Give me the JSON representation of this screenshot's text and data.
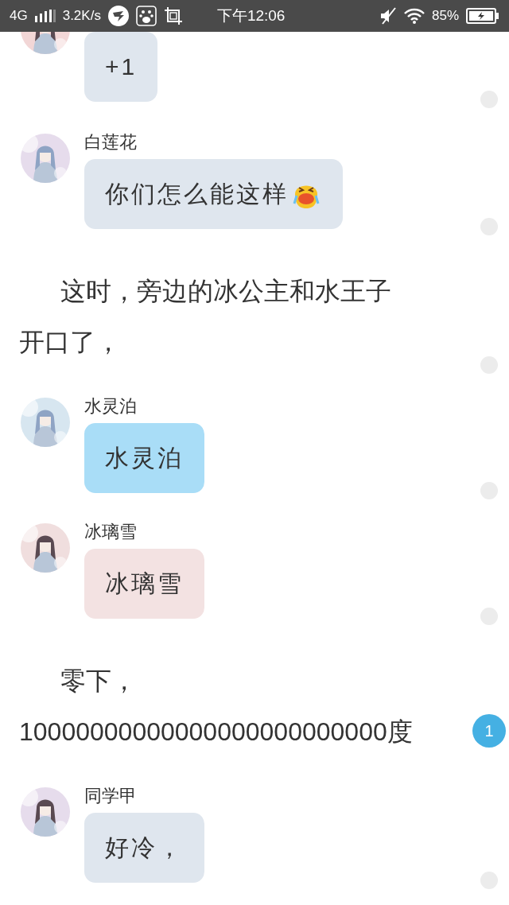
{
  "status_bar": {
    "network": "4G",
    "speed": "3.2K/s",
    "time": "下午12:06",
    "battery": "85%"
  },
  "items": [
    {
      "kind": "message",
      "bubble": {
        "text": "+1",
        "color": "#dfe6ee"
      }
    },
    {
      "kind": "message",
      "name": "白莲花",
      "bubble": {
        "text": "你们怎么能这样",
        "color": "#dfe6ee",
        "has_emoji": true
      }
    },
    {
      "kind": "narration",
      "lines": [
        "这时，旁边的冰公主和水王子",
        "开口了，"
      ]
    },
    {
      "kind": "message",
      "name": "水灵泊",
      "bubble": {
        "text": "水灵泊",
        "color": "#a9ddf7"
      }
    },
    {
      "kind": "message",
      "name": "冰璃雪",
      "bubble": {
        "text": "冰璃雪",
        "color": "#f3e2e2"
      }
    },
    {
      "kind": "narration",
      "lines": [
        "零下，",
        "10000000000000000000000000度"
      ],
      "badge": "1"
    },
    {
      "kind": "message",
      "name": "同学甲",
      "bubble": {
        "text": "好冷，",
        "color": "#dfe6ee"
      }
    }
  ]
}
